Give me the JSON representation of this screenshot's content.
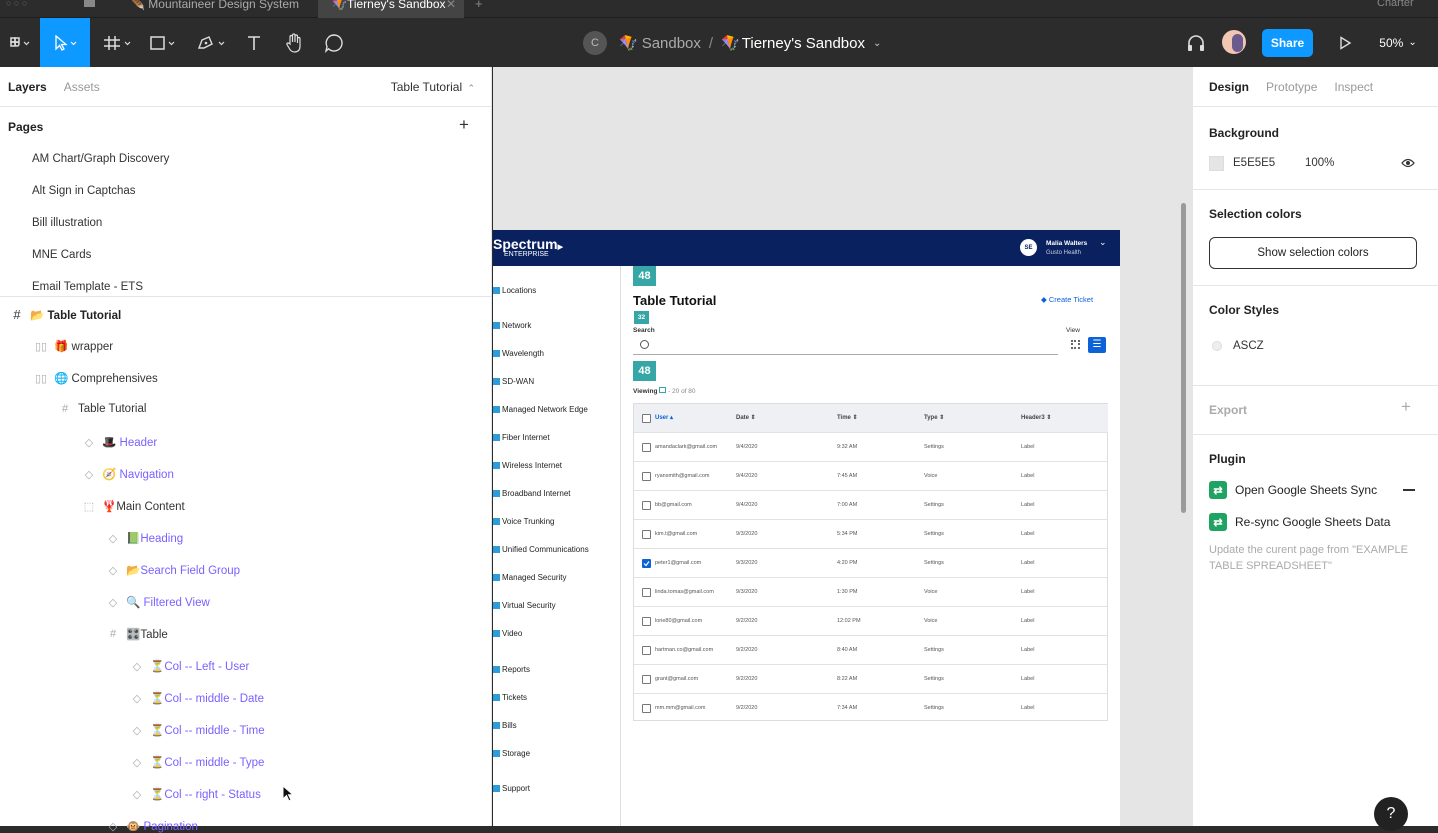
{
  "tabs": [
    {
      "label": "Mountaineer Design System"
    },
    {
      "label": "Tierney's Sandbox"
    }
  ],
  "tab_right": "Charter",
  "breadcrumb": {
    "project": "Sandbox",
    "separator": "/",
    "file": "Tierney's Sandbox",
    "avatar_letter": "C"
  },
  "toolbar": {
    "share": "Share",
    "zoom": "50%"
  },
  "layers_panel": {
    "tabs": {
      "layers": "Layers",
      "assets": "Assets"
    },
    "current_page": "Table Tutorial",
    "pages_title": "Pages",
    "pages": [
      "AM Chart/Graph Discovery",
      "Alt Sign in Captchas",
      "Bill illustration",
      "MNE Cards",
      "Email Template - ETS"
    ],
    "layers": [
      {
        "label": "📂 Table Tutorial",
        "icon": "#",
        "indent": 0,
        "bold": true,
        "component": false
      },
      {
        "label": "🎁 wrapper",
        "icon": "▯▯",
        "indent": 1,
        "bold": false,
        "component": false
      },
      {
        "label": "🌐 Comprehensives",
        "icon": "▯▯",
        "indent": 1,
        "bold": false,
        "component": false
      },
      {
        "label": "Table Tutorial",
        "icon": "#",
        "indent": 2,
        "bold": false,
        "component": false
      },
      {
        "label": "🎩 Header",
        "icon": "◇",
        "indent": 3,
        "bold": false,
        "component": true
      },
      {
        "label": "🧭 Navigation",
        "icon": "◇",
        "indent": 3,
        "bold": false,
        "component": true
      },
      {
        "label": "🦞Main Content",
        "icon": "⬚",
        "indent": 3,
        "bold": false,
        "component": false
      },
      {
        "label": "📗Heading",
        "icon": "◇",
        "indent": 4,
        "bold": false,
        "component": true
      },
      {
        "label": "📂Search Field Group",
        "icon": "◇",
        "indent": 4,
        "bold": false,
        "component": true
      },
      {
        "label": "🔍 Filtered View",
        "icon": "◇",
        "indent": 4,
        "bold": false,
        "component": true
      },
      {
        "label": "🎛️Table",
        "icon": "#",
        "indent": 4,
        "bold": false,
        "component": false
      },
      {
        "label": "⏳Col -- Left - User",
        "icon": "◇",
        "indent": 5,
        "bold": false,
        "component": true
      },
      {
        "label": "⏳Col -- middle -  Date",
        "icon": "◇",
        "indent": 5,
        "bold": false,
        "component": true
      },
      {
        "label": "⏳Col -- middle - Time",
        "icon": "◇",
        "indent": 5,
        "bold": false,
        "component": true
      },
      {
        "label": "⏳Col -- middle - Type",
        "icon": "◇",
        "indent": 5,
        "bold": false,
        "component": true
      },
      {
        "label": "⏳Col -- right - Status",
        "icon": "◇",
        "indent": 5,
        "bold": false,
        "component": true
      },
      {
        "label": "🐵 Pagination",
        "icon": "◇",
        "indent": 4,
        "bold": false,
        "component": true
      }
    ]
  },
  "design_panel": {
    "tabs": {
      "design": "Design",
      "prototype": "Prototype",
      "inspect": "Inspect"
    },
    "background": {
      "title": "Background",
      "hex": "E5E5E5",
      "opacity": "100%"
    },
    "selection_colors": {
      "title": "Selection colors",
      "button": "Show selection colors"
    },
    "color_styles": {
      "title": "Color Styles",
      "name": "ASCZ"
    },
    "export": {
      "title": "Export"
    },
    "plugin": {
      "title": "Plugin",
      "items": [
        "Open Google Sheets Sync",
        "Re-sync Google Sheets Data"
      ],
      "note": "Update the curent page from \"EXAMPLE TABLE SPREADSHEET\""
    }
  },
  "mock": {
    "logo": "Spectrum",
    "logo_sub": "ENTERPRISE",
    "user_initials": "SE",
    "user_name": "Malia Walters",
    "user_company": "Gusto Health",
    "nav": [
      "Locations",
      "Network",
      "Wavelength",
      "SD-WAN",
      "Managed Network Edge",
      "Fiber Internet",
      "Wireless Internet",
      "Broadband Internet",
      "Voice Trunking",
      "Unified Communications",
      "Managed Security",
      "Virtual Security",
      "Video",
      "Reports",
      "Tickets",
      "Bills",
      "Storage",
      "Support"
    ],
    "title": "Table Tutorial",
    "create_ticket": "Create Ticket",
    "search_label": "Search",
    "view_label": "View",
    "viewing": "Viewing",
    "viewing_range": "- 20 of 80",
    "spacing_tags": [
      "48",
      "32",
      "48"
    ],
    "columns": [
      "User",
      "Date",
      "Time",
      "Type",
      "Header3"
    ],
    "rows": [
      {
        "user": "amandaclark@gmail.com",
        "date": "9/4/2020",
        "time": "9:32 AM",
        "type": "Settings",
        "status": "Label",
        "checked": false
      },
      {
        "user": "ryansmith@gmail.com",
        "date": "9/4/2020",
        "time": "7:45 AM",
        "type": "Voice",
        "status": "Label",
        "checked": false
      },
      {
        "user": "bb@gmail.com",
        "date": "9/4/2020",
        "time": "7:00 AM",
        "type": "Settings",
        "status": "Label",
        "checked": false
      },
      {
        "user": "kim.t@gmail.com",
        "date": "9/3/2020",
        "time": "5:34 PM",
        "type": "Settings",
        "status": "Label",
        "checked": false
      },
      {
        "user": "peter1@gmail.com",
        "date": "9/3/2020",
        "time": "4:20 PM",
        "type": "Settings",
        "status": "Label",
        "checked": true
      },
      {
        "user": "linda.tomas@gmail.com",
        "date": "9/3/2020",
        "time": "1:30 PM",
        "type": "Voice",
        "status": "Label",
        "checked": false
      },
      {
        "user": "lorie80@gmail.com",
        "date": "9/2/2020",
        "time": "12:02 PM",
        "type": "Voice",
        "status": "Label",
        "checked": false
      },
      {
        "user": "hartman.co@gmail.com",
        "date": "9/2/2020",
        "time": "8:40 AM",
        "type": "Settings",
        "status": "Label",
        "checked": false
      },
      {
        "user": "grant@gmail.com",
        "date": "9/2/2020",
        "time": "8:22 AM",
        "type": "Settings",
        "status": "Label",
        "checked": false
      },
      {
        "user": "mm.mm@gmail.com",
        "date": "9/2/2020",
        "time": "7:34 AM",
        "type": "Settings",
        "status": "Label",
        "checked": false
      }
    ]
  },
  "help_label": "?",
  "colors": {
    "accent": "#0d99ff",
    "component": "#7b61ff",
    "spectrum_navy": "#0a2160",
    "spacing_tag": "#37a6a6",
    "plugin_green": "#1ea362"
  }
}
